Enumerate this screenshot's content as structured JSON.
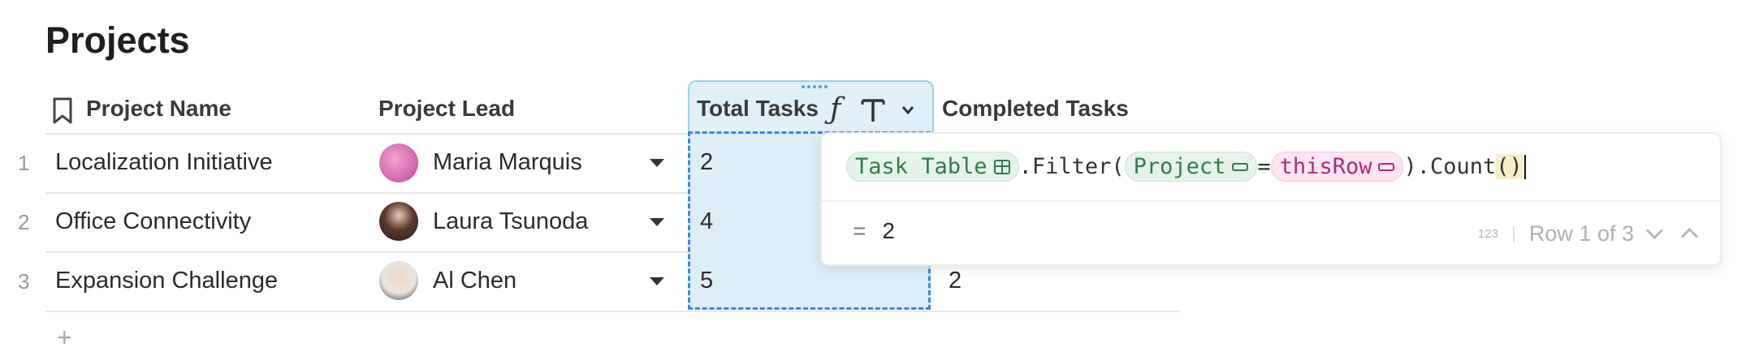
{
  "page": {
    "title": "Projects"
  },
  "columns": {
    "project_name": "Project Name",
    "project_lead": "Project Lead",
    "total_tasks": "Total Tasks",
    "completed_tasks": "Completed Tasks"
  },
  "rows": [
    {
      "num": "1",
      "name": "Localization Initiative",
      "lead": "Maria Marquis",
      "total": "2",
      "completed": ""
    },
    {
      "num": "2",
      "name": "Office Connectivity",
      "lead": "Laura Tsunoda",
      "total": "4",
      "completed": ""
    },
    {
      "num": "3",
      "name": "Expansion Challenge",
      "lead": "Al Chen",
      "total": "5",
      "completed": "2"
    }
  ],
  "add_row": "+",
  "formula": {
    "table_chip": "Task Table",
    "filter_text": ".Filter(",
    "project_chip": "Project",
    "equals": "=",
    "thisrow_chip": "thisRow",
    "count_prefix": ").Count",
    "paren_open": "(",
    "paren_close": ")",
    "result_eq": "=",
    "result_value": "2",
    "type_badge": "123",
    "row_nav": "Row 1 of 3"
  },
  "icons": [
    "bookmark-icon",
    "formula-icon",
    "text-type-icon",
    "chevron-down-icon",
    "dropdown-caret-icon",
    "table-icon",
    "column-ref-icon",
    "chevron-up-icon",
    "plus-icon",
    "drag-handle-icon"
  ],
  "colors": {
    "selection_fill": "#ddeef7",
    "selection_border": "#3b82f6",
    "chip_green": "#2f7d4a",
    "chip_pink": "#b32a78"
  }
}
